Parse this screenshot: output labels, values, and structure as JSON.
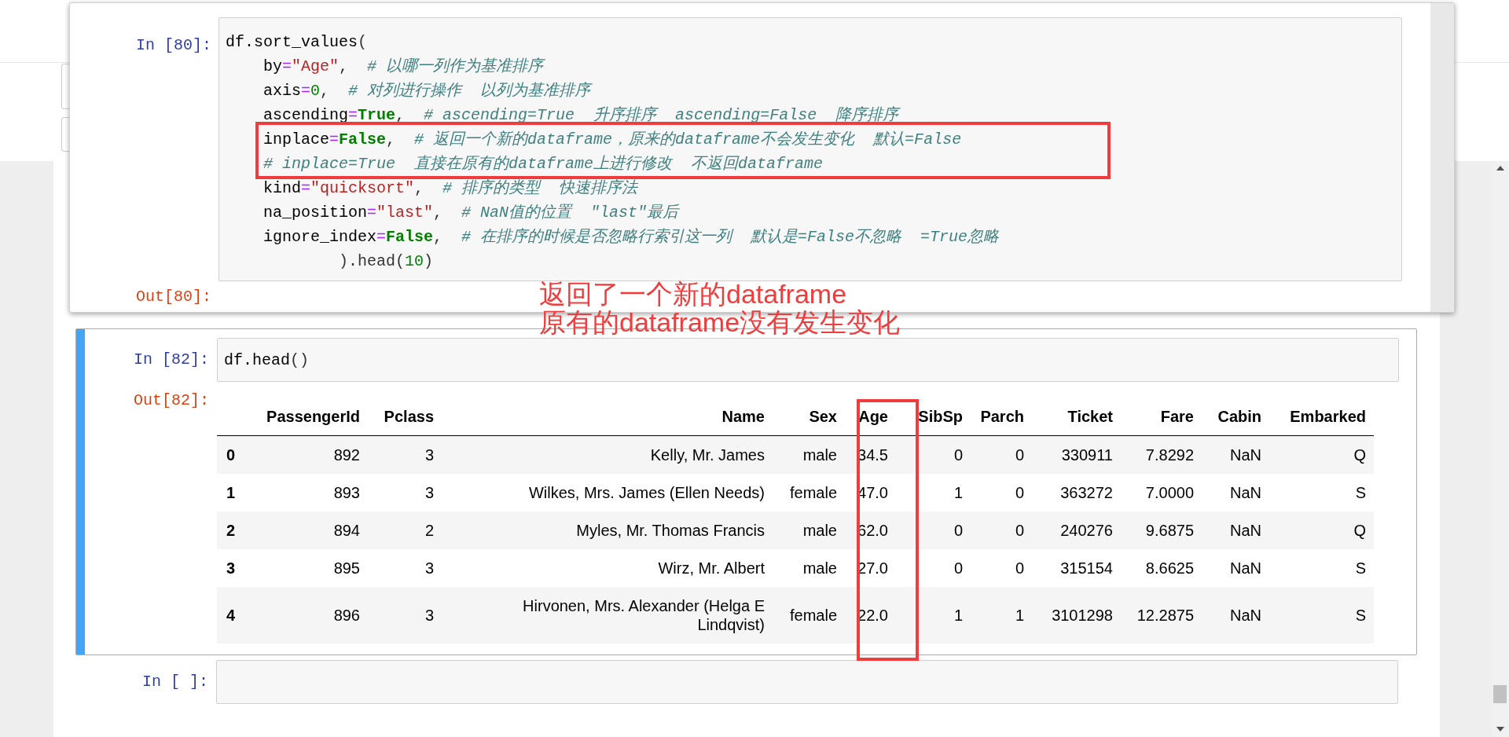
{
  "pinned_cell": {
    "prompt": "In [80]:",
    "output_prompt": "Out[80]:",
    "code_lines": [
      [
        {
          "kind": "name",
          "text": "df.sort_values"
        },
        {
          "kind": "plain",
          "text": "("
        }
      ],
      [
        {
          "kind": "name",
          "text": "    by"
        },
        {
          "kind": "op",
          "text": "="
        },
        {
          "kind": "string",
          "text": "\"Age\""
        },
        {
          "kind": "plain",
          "text": ",  "
        },
        {
          "kind": "comment",
          "text": "# 以哪一列作为基准排序"
        }
      ],
      [
        {
          "kind": "name",
          "text": "    axis"
        },
        {
          "kind": "op",
          "text": "="
        },
        {
          "kind": "number",
          "text": "0"
        },
        {
          "kind": "plain",
          "text": ",  "
        },
        {
          "kind": "comment",
          "text": "# 对列进行操作  以列为基准排序"
        }
      ],
      [
        {
          "kind": "name",
          "text": "    ascending"
        },
        {
          "kind": "op",
          "text": "="
        },
        {
          "kind": "keyword",
          "text": "True"
        },
        {
          "kind": "plain",
          "text": ",  "
        },
        {
          "kind": "comment",
          "text": "# ascending=True  升序排序  ascending=False  降序排序"
        }
      ],
      [
        {
          "kind": "name",
          "text": "    inplace"
        },
        {
          "kind": "op",
          "text": "="
        },
        {
          "kind": "keyword",
          "text": "False"
        },
        {
          "kind": "plain",
          "text": ",  "
        },
        {
          "kind": "comment",
          "text": "# 返回一个新的dataframe，原来的dataframe不会发生变化  默认=False"
        }
      ],
      [
        {
          "kind": "comment",
          "text": "    # inplace=True  直接在原有的dataframe上进行修改  不返回dataframe"
        }
      ],
      [
        {
          "kind": "name",
          "text": "    kind"
        },
        {
          "kind": "op",
          "text": "="
        },
        {
          "kind": "string",
          "text": "\"quicksort\""
        },
        {
          "kind": "plain",
          "text": ",  "
        },
        {
          "kind": "comment",
          "text": "# 排序的类型  快速排序法"
        }
      ],
      [
        {
          "kind": "name",
          "text": "    na_position"
        },
        {
          "kind": "op",
          "text": "="
        },
        {
          "kind": "string",
          "text": "\"last\""
        },
        {
          "kind": "plain",
          "text": ",  "
        },
        {
          "kind": "comment",
          "text": "# NaN值的位置  \"last\"最后"
        }
      ],
      [
        {
          "kind": "name",
          "text": "    ignore_index"
        },
        {
          "kind": "op",
          "text": "="
        },
        {
          "kind": "keyword",
          "text": "False"
        },
        {
          "kind": "plain",
          "text": ",  "
        },
        {
          "kind": "comment",
          "text": "# 在排序的时候是否忽略行索引这一列  默认是=False不忽略  =True忽略"
        }
      ],
      [
        {
          "kind": "plain",
          "text": "            ).head("
        },
        {
          "kind": "number",
          "text": "10"
        },
        {
          "kind": "plain",
          "text": ")"
        }
      ]
    ]
  },
  "annotation": [
    "返回了一个新的dataframe",
    "原有的dataframe没有发生变化"
  ],
  "cell": {
    "prompt": "In [82]:",
    "selected": true,
    "output_prompt": "Out[82]:",
    "code_lines": [
      [
        {
          "kind": "name",
          "text": "df.head"
        },
        {
          "kind": "plain",
          "text": "()"
        }
      ]
    ],
    "table": {
      "columns": [
        null,
        "PassengerId",
        "Pclass",
        "Name",
        "Sex",
        "Age",
        "SibSp",
        "Parch",
        "Ticket",
        "Fare",
        "Cabin",
        "Embarked"
      ],
      "rows": [
        [
          "0",
          "892",
          "3",
          "Kelly, Mr. James",
          "male",
          "34.5",
          "0",
          "0",
          "330911",
          "7.8292",
          "NaN",
          "Q"
        ],
        [
          "1",
          "893",
          "3",
          "Wilkes, Mrs. James (Ellen Needs)",
          "female",
          "47.0",
          "1",
          "0",
          "363272",
          "7.0000",
          "NaN",
          "S"
        ],
        [
          "2",
          "894",
          "2",
          "Myles, Mr. Thomas Francis",
          "male",
          "62.0",
          "0",
          "0",
          "240276",
          "9.6875",
          "NaN",
          "Q"
        ],
        [
          "3",
          "895",
          "3",
          "Wirz, Mr. Albert",
          "male",
          "27.0",
          "0",
          "0",
          "315154",
          "8.6625",
          "NaN",
          "S"
        ],
        [
          "4",
          "896",
          "3",
          "Hirvonen, Mrs. Alexander (Helga E Lindqvist)",
          "female",
          "22.0",
          "1",
          "1",
          "3101298",
          "12.2875",
          "NaN",
          "S"
        ]
      ]
    }
  },
  "empty_cell": {
    "prompt": "In [ ]:"
  }
}
